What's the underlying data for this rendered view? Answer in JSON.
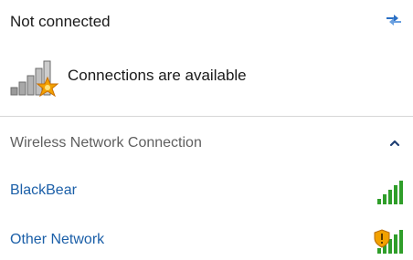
{
  "header": {
    "title": "Not connected",
    "refresh_icon": "refresh-icon"
  },
  "availability": {
    "text": "Connections are available",
    "icon": "network-available-icon"
  },
  "section": {
    "title": "Wireless Network Connection",
    "toggle_icon": "chevron-up-icon"
  },
  "networks": [
    {
      "name": "BlackBear",
      "signal_bars": 5,
      "secured": false,
      "signal_icon": "signal-strength-icon"
    },
    {
      "name": "Other Network",
      "signal_bars": 5,
      "secured": false,
      "warning": true,
      "signal_icon": "signal-warning-icon"
    }
  ],
  "colors": {
    "link": "#1b5fa8",
    "signal_green": "#2f9e2a",
    "warning_orange": "#e08a00",
    "section_text": "#5f5f5f"
  }
}
